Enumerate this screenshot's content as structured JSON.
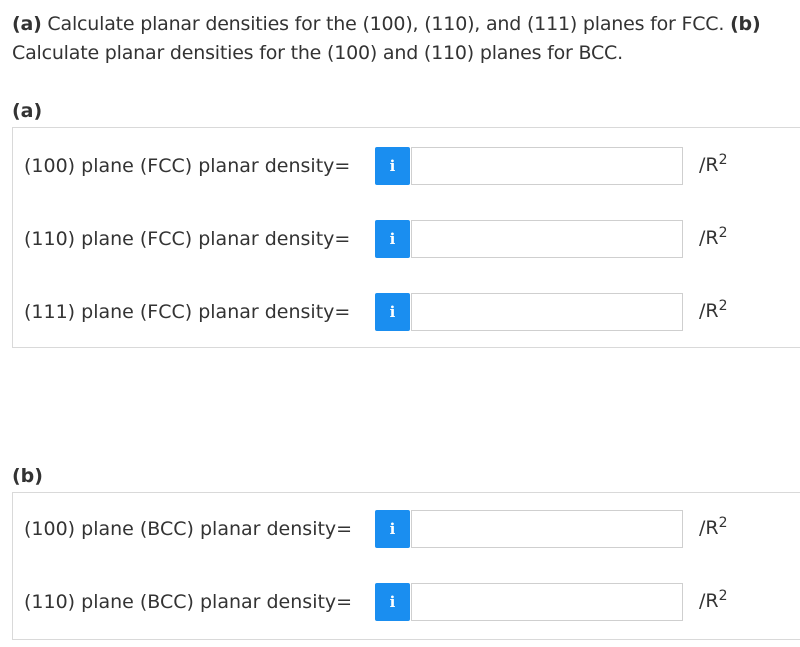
{
  "question": {
    "part_a_tag": "(a)",
    "part_a_text": " Calculate planar densities for the (100), (110), and (111) planes for FCC. ",
    "part_b_tag": "(b)",
    "part_b_text": " Calculate planar densities for the (100) and (110) planes for BCC."
  },
  "part_a": {
    "label": "(a)",
    "rows": [
      {
        "label": "(100) plane (FCC) planar density=",
        "value": "",
        "unit": "/R",
        "exponent": "2"
      },
      {
        "label": "(110) plane (FCC) planar density=",
        "value": "",
        "unit": "/R",
        "exponent": "2"
      },
      {
        "label": "(111) plane (FCC) planar density=",
        "value": "",
        "unit": "/R",
        "exponent": "2"
      }
    ]
  },
  "part_b": {
    "label": "(b)",
    "rows": [
      {
        "label": "(100) plane (BCC) planar density=",
        "value": "",
        "unit": "/R",
        "exponent": "2"
      },
      {
        "label": "(110) plane (BCC) planar density=",
        "value": "",
        "unit": "/R",
        "exponent": "2"
      }
    ]
  },
  "info_icon_glyph": "i",
  "colors": {
    "info_button": "#1a8ef0",
    "text": "#333333",
    "border": "#d9d9d9"
  }
}
